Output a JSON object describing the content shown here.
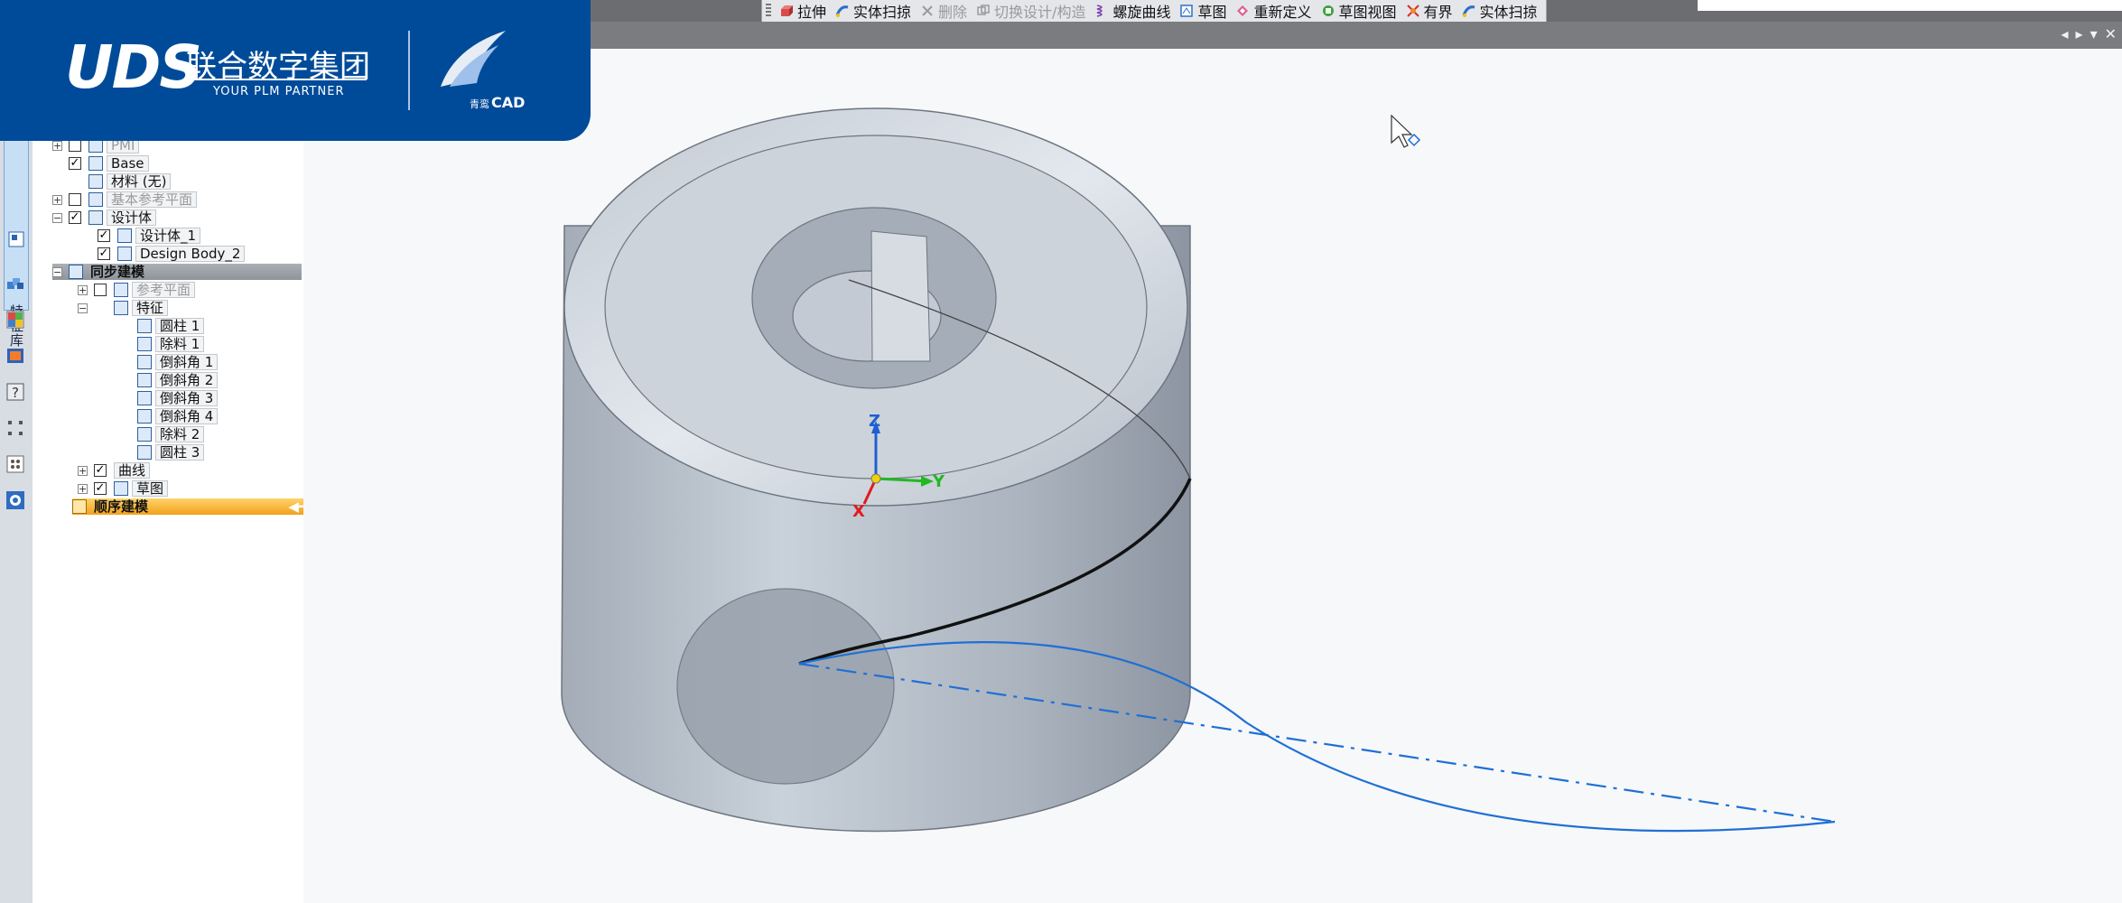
{
  "toolbar": {
    "items": [
      {
        "label": "拉伸",
        "icon": "extrude-icon",
        "disabled": false
      },
      {
        "label": "实体扫掠",
        "icon": "sweep-icon",
        "disabled": false
      },
      {
        "label": "删除",
        "icon": "delete-icon",
        "disabled": true
      },
      {
        "label": "切换设计/构造",
        "icon": "toggle-design-icon",
        "disabled": true
      },
      {
        "label": "螺旋曲线",
        "icon": "helix-icon",
        "disabled": false
      },
      {
        "label": "草图",
        "icon": "sketch-icon",
        "disabled": false
      },
      {
        "label": "重新定义",
        "icon": "redefine-icon",
        "disabled": false
      },
      {
        "label": "草图视图",
        "icon": "sketch-view-icon",
        "disabled": false
      },
      {
        "label": "有界",
        "icon": "bounded-icon",
        "disabled": false
      },
      {
        "label": "实体扫掠",
        "icon": "sweep-icon",
        "disabled": false
      }
    ],
    "window_controls": [
      "◂",
      "▸",
      "▾",
      "✕"
    ]
  },
  "logo": {
    "brand": "UDS",
    "company": "联合数字集团",
    "tagline": "YOUR PLM PARTNER",
    "product_prefix": "青鸾",
    "product": "CAD"
  },
  "left_rail": {
    "tab_label": "特征库"
  },
  "tree": {
    "pmi": "PMI",
    "base": "Base",
    "material": "材料 (无)",
    "ref_planes": "基本参考平面",
    "design_bodies": "设计体",
    "design_body_1": "设计体_1",
    "design_body_2": "Design Body_2",
    "sync_modeling": "同步建模",
    "ref_plane": "参考平面",
    "features": "特征",
    "feature_items": [
      "圆柱 1",
      "除料 1",
      "倒斜角 1",
      "倒斜角 2",
      "倒斜角 3",
      "倒斜角 4",
      "除料 2",
      "圆柱 3"
    ],
    "curves": "曲线",
    "sketch": "草图",
    "ordered_modeling": "顺序建模"
  },
  "triad": {
    "z": "Z",
    "y": "Y",
    "x": "X"
  },
  "colors": {
    "brand_blue": "#004b99",
    "curve_blue": "#1f6fd6",
    "triad_z": "#1f5fd0",
    "triad_y": "#22b822",
    "triad_x": "#e01b1b",
    "order_orange": "#f2a11c"
  }
}
